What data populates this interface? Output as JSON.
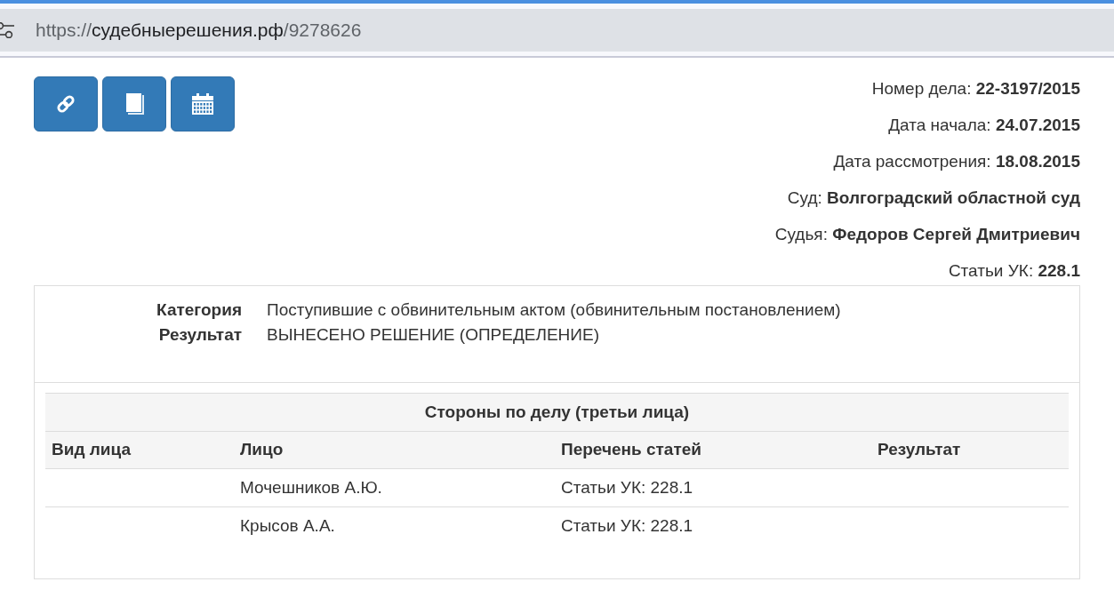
{
  "browser": {
    "address_bar": {
      "scheme": "https://",
      "host": "судебныерешения.рф",
      "path": "/9278626"
    }
  },
  "toolbar": {
    "buttons": [
      {
        "kind": "link"
      },
      {
        "kind": "book"
      },
      {
        "kind": "calendar"
      }
    ]
  },
  "case_info": [
    {
      "label": "Номер дела:",
      "value": "22-3197/2015"
    },
    {
      "label": "Дата начала:",
      "value": "24.07.2015"
    },
    {
      "label": "Дата рассмотрения:",
      "value": "18.08.2015"
    },
    {
      "label": "Суд:",
      "value": "Волгоградский областной суд"
    },
    {
      "label": "Судья:",
      "value": "Федоров Сергей Дмитриевич"
    },
    {
      "label": "Статьи УК:",
      "value": "228.1"
    }
  ],
  "details": [
    {
      "label": "Категория",
      "value": "Поступившие с обвинительным актом (обвинительным постановлением)"
    },
    {
      "label": "Результат",
      "value": "ВЫНЕСЕНО РЕШЕНИЕ (ОПРЕДЕЛЕНИЕ)"
    }
  ],
  "parties_table": {
    "title": "Стороны по делу (третьи лица)",
    "columns": [
      "Вид лица",
      "Лицо",
      "Перечень статей",
      "Результат"
    ],
    "rows": [
      {
        "person": "Мочешников А.Ю.",
        "articles": "Статьи УК: 228.1"
      },
      {
        "person": "Крысов А.А.",
        "articles": "Статьи УК: 228.1"
      }
    ]
  }
}
